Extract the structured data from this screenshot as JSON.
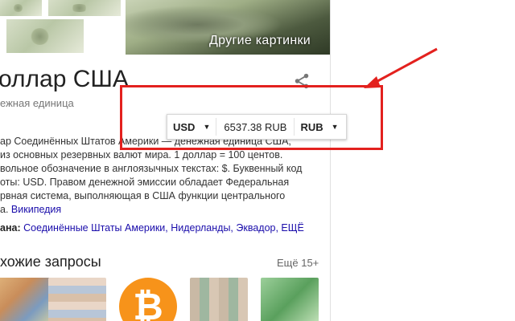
{
  "knowledge_panel": {
    "images": {
      "other_pictures_label": "Другие картинки"
    },
    "title": "оллар США",
    "subtitle": "ежная единица",
    "description_lines": [
      "ар Соединённых Штатов Америки — денежная единица США,",
      "из основных резервных валют мира. 1 доллар = 100 центов.",
      "вольное обозначение в англоязычных текстах: $. Буквенный код",
      "оты: USD. Правом денежной эмиссии обладает Федеральная",
      "рвная система, выполняющая в США функции центрального",
      "а."
    ],
    "wiki_link": "Википедия",
    "country_label": "ана:",
    "countries": "Соединённые Штаты Америки, Нидерланды, Эквадор, ЕЩЁ",
    "related_heading": "хожие запросы",
    "related_more": "Ещё 15+",
    "bitcoin_symbol": "₿"
  },
  "converter": {
    "from_currency": "USD",
    "value": "6537.38 RUB",
    "to_currency": "RUB",
    "dropdown_glyph": "▼"
  },
  "colors": {
    "annotation_red": "#e3211e",
    "link_blue": "#1a0dab",
    "bitcoin_orange": "#f7931a"
  }
}
